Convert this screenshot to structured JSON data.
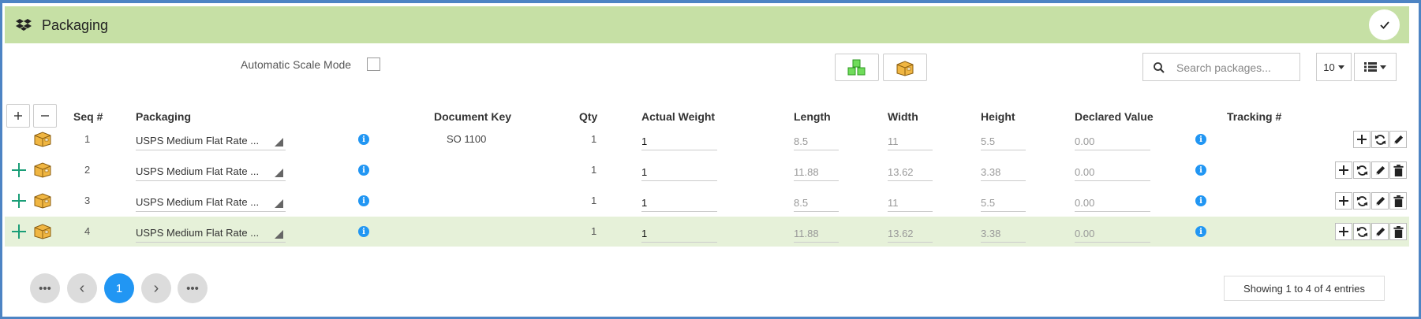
{
  "header": {
    "title": "Packaging",
    "icon": "dropbox-icon",
    "done_icon": "check-icon"
  },
  "toolbar": {
    "auto_scale_label": "Automatic Scale Mode",
    "auto_scale_checked": false,
    "search_placeholder": "Search packages...",
    "page_size": "10"
  },
  "columns": [
    "Seq #",
    "Packaging",
    "Document Key",
    "Qty",
    "Actual Weight",
    "Length",
    "Width",
    "Height",
    "Declared Value",
    "Tracking #"
  ],
  "rows": [
    {
      "seq": "1",
      "packaging": "USPS Medium Flat Rate ...",
      "document_key": "SO 1100",
      "qty": "1",
      "actual_weight": "1",
      "length": "8.5",
      "width": "11",
      "height": "5.5",
      "declared_value": "0.00",
      "has_expand": false,
      "has_delete": false,
      "selected": false
    },
    {
      "seq": "2",
      "packaging": "USPS Medium Flat Rate ...",
      "document_key": "",
      "qty": "1",
      "actual_weight": "1",
      "length": "11.88",
      "width": "13.62",
      "height": "3.38",
      "declared_value": "0.00",
      "has_expand": true,
      "has_delete": true,
      "selected": false
    },
    {
      "seq": "3",
      "packaging": "USPS Medium Flat Rate ...",
      "document_key": "",
      "qty": "1",
      "actual_weight": "1",
      "length": "8.5",
      "width": "11",
      "height": "5.5",
      "declared_value": "0.00",
      "has_expand": true,
      "has_delete": true,
      "selected": false
    },
    {
      "seq": "4",
      "packaging": "USPS Medium Flat Rate ...",
      "document_key": "",
      "qty": "1",
      "actual_weight": "1",
      "length": "11.88",
      "width": "13.62",
      "height": "3.38",
      "declared_value": "0.00",
      "has_expand": true,
      "has_delete": true,
      "selected": true
    }
  ],
  "pagination": {
    "current_page": "1",
    "first": "•••",
    "prev": "‹",
    "next": "›",
    "last": "•••"
  },
  "footer": {
    "showing": "Showing 1 to 4 of 4 entries"
  },
  "colors": {
    "header_bg": "#c6e0a5",
    "selected_row": "#e6f1d9",
    "accent": "#2196f3",
    "frame": "#4d84c4",
    "expand_plus": "#1a9e77"
  }
}
